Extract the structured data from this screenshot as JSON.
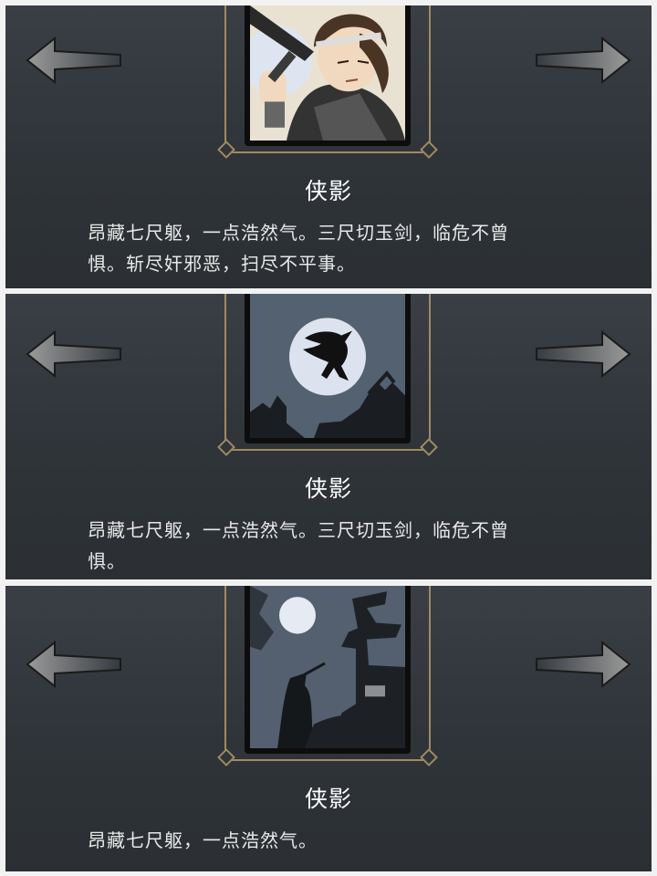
{
  "panels": [
    {
      "name": "侠影",
      "desc_lines": [
        "昂藏七尺躯，一点浩然气。三尺切玉剑，临危不曾",
        "惧。斩尽奸邪恶，扫尽不平事。"
      ],
      "card_art": "swordsman-portrait"
    },
    {
      "name": "侠影",
      "desc_lines": [
        "昂藏七尺躯，一点浩然气。三尺切玉剑，临危不曾",
        "惧。"
      ],
      "card_art": "leaping-shadow-moon"
    },
    {
      "name": "侠影",
      "desc_lines": [
        "昂藏七尺躯，一点浩然气。"
      ],
      "card_art": "figure-pagoda-moon"
    }
  ],
  "icons": {
    "prev": "arrow-left-icon",
    "next": "arrow-right-icon"
  },
  "colors": {
    "panel_bg": "#33383d",
    "frame_gold": "#a08a64",
    "text": "#ffffff",
    "moon": "#dde3ee"
  }
}
